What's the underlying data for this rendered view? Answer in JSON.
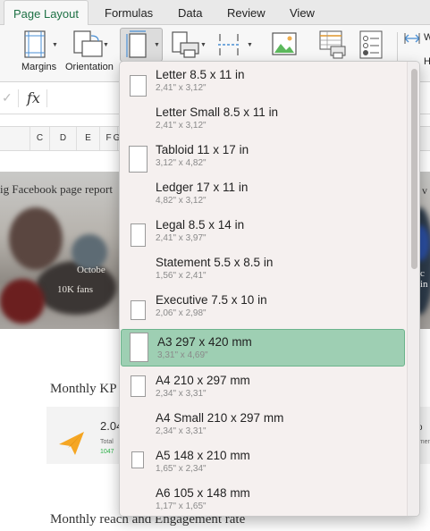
{
  "tabs": [
    {
      "label": "Page Layout",
      "active": true
    },
    {
      "label": "Formulas",
      "active": false
    },
    {
      "label": "Data",
      "active": false
    },
    {
      "label": "Review",
      "active": false
    },
    {
      "label": "View",
      "active": false
    }
  ],
  "ribbon": {
    "margins_label": "Margins",
    "orientation_label": "Orientation",
    "cut_label_w": "W",
    "cut_label_h": "H",
    "icons": [
      "margins-icon",
      "orientation-icon",
      "size-icon",
      "print-area-icon",
      "breaks-icon",
      "background-icon",
      "print-titles-icon",
      "page-setup-icon",
      "width-icon"
    ]
  },
  "formula_bar": {
    "cancel_symbol": "✓",
    "fx_symbol": "fx",
    "content": ""
  },
  "columns": [
    "C",
    "D",
    "E",
    "F",
    "G"
  ],
  "sheet": {
    "banner_title": "ig Facebook page report",
    "banner_fragment_1": "Octobe",
    "banner_fragment_2": "10K fans",
    "banner_fragment_right": "v",
    "banner_fragment_right_2": "c in",
    "heading_1": "Monthly KP",
    "kpi_value": "2.04",
    "kpi_sub": "Total",
    "kpi_green": "1047",
    "kpi_right_value": "%",
    "kpi_right_sub": "gemen",
    "heading_2": "Monthly reach and Engagement rate"
  },
  "page_sizes": [
    {
      "name": "Letter 8.5 x 11 in",
      "dims": "2,41\" x 3,12\"",
      "selected": false
    },
    {
      "name": "Letter Small 8.5 x 11 in",
      "dims": "2,41\" x 3,12\"",
      "selected": false
    },
    {
      "name": "Tabloid 11 x 17 in",
      "dims": "3,12\" x 4,82\"",
      "selected": false
    },
    {
      "name": "Ledger 17 x 11 in",
      "dims": "4,82\" x 3,12\"",
      "selected": false
    },
    {
      "name": "Legal 8.5 x 14 in",
      "dims": "2,41\" x 3,97\"",
      "selected": false
    },
    {
      "name": "Statement 5.5 x 8.5 in",
      "dims": "1,56\" x 2,41\"",
      "selected": false
    },
    {
      "name": "Executive 7.5 x 10 in",
      "dims": "2,06\" x 2,98\"",
      "selected": false
    },
    {
      "name": "A3 297 x 420 mm",
      "dims": "3,31\" x 4,69\"",
      "selected": true
    },
    {
      "name": "A4 210 x 297 mm",
      "dims": "2,34\" x 3,31\"",
      "selected": false
    },
    {
      "name": "A4 Small 210 x 297 mm",
      "dims": "2,34\" x 3,31\"",
      "selected": false
    },
    {
      "name": "A5 148 x 210 mm",
      "dims": "1,65\" x 2,34\"",
      "selected": false
    },
    {
      "name": "A6 105 x 148 mm",
      "dims": "1,17\" x 1,65\"",
      "selected": false
    }
  ],
  "colors": {
    "accent_green": "#1e7145",
    "selection": "#9ecfb3",
    "kpi_icon": "#f5a623"
  }
}
